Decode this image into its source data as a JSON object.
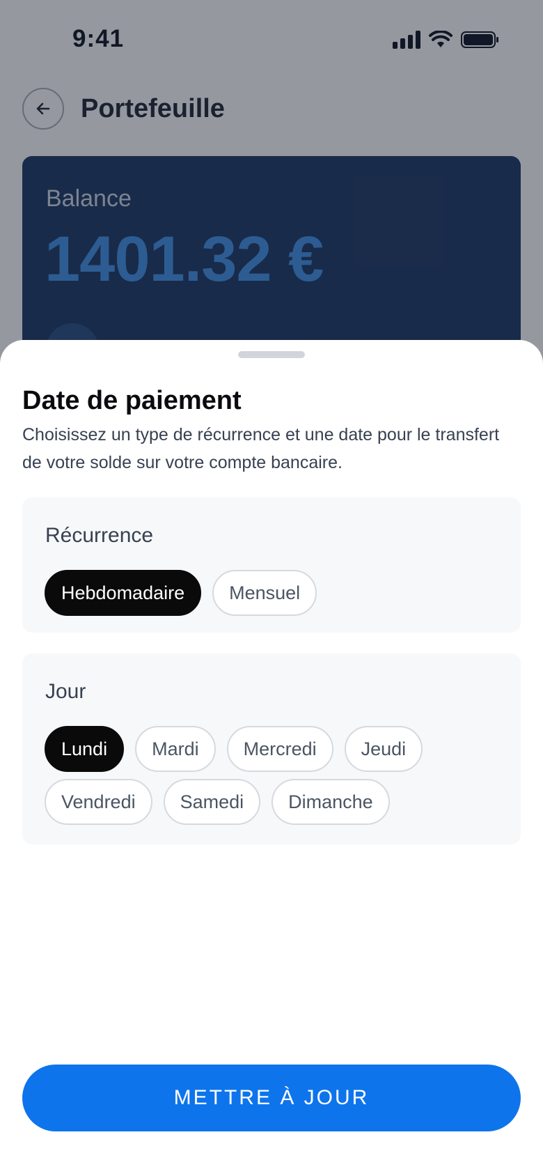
{
  "status_bar": {
    "time": "9:41"
  },
  "header": {
    "title": "Portefeuille"
  },
  "balance_card": {
    "label": "Balance",
    "value": "1401.32 €"
  },
  "sheet": {
    "title": "Date de paiement",
    "description": "Choisissez un type de récurrence et une date pour le transfert de votre solde sur votre compte bancaire.",
    "recurrence": {
      "label": "Récurrence",
      "options": [
        {
          "label": "Hebdomadaire",
          "selected": true
        },
        {
          "label": "Mensuel",
          "selected": false
        }
      ]
    },
    "day": {
      "label": "Jour",
      "options": [
        {
          "label": "Lundi",
          "selected": true
        },
        {
          "label": "Mardi",
          "selected": false
        },
        {
          "label": "Mercredi",
          "selected": false
        },
        {
          "label": "Jeudi",
          "selected": false
        },
        {
          "label": "Vendredi",
          "selected": false
        },
        {
          "label": "Samedi",
          "selected": false
        },
        {
          "label": "Dimanche",
          "selected": false
        }
      ]
    },
    "update_button": "METTRE À JOUR"
  },
  "colors": {
    "accent": "#0e74ec",
    "selected_chip": "#0a0a0a",
    "card_background": "#1e3a64",
    "balance_value": "#3f8ee0"
  }
}
